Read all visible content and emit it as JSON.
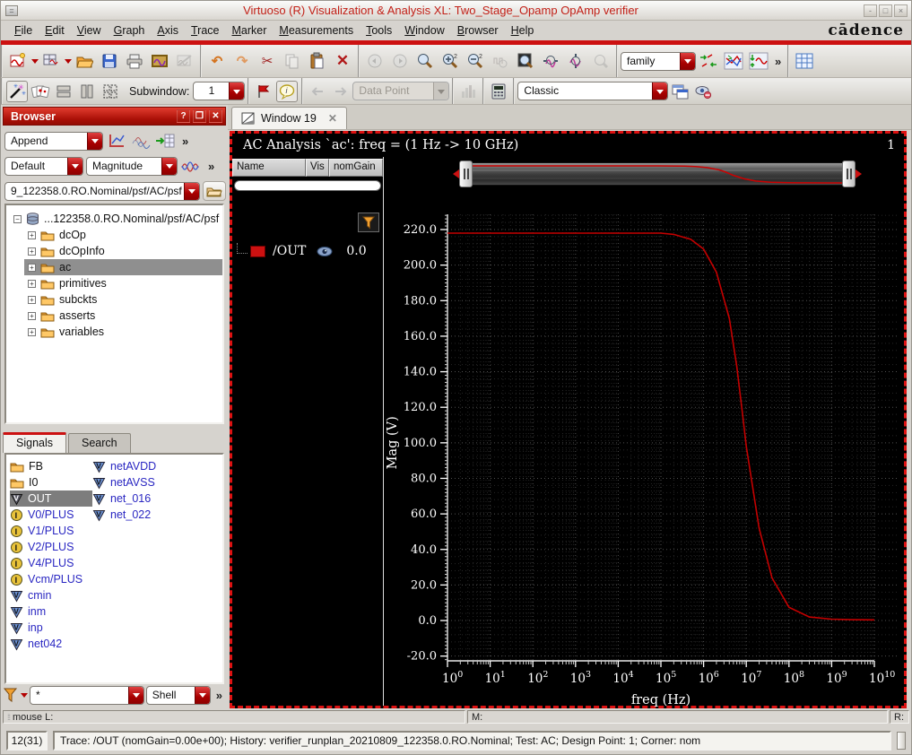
{
  "window": {
    "title": "Virtuoso (R) Visualization & Analysis XL: Two_Stage_Opamp OpAmp verifier",
    "brand": "cādence"
  },
  "menubar": {
    "items": [
      "File",
      "Edit",
      "View",
      "Graph",
      "Axis",
      "Trace",
      "Marker",
      "Measurements",
      "Tools",
      "Window",
      "Browser",
      "Help"
    ]
  },
  "toolbar": {
    "family_value": "family",
    "subwindow_label": "Subwindow:",
    "subwindow_value": "1",
    "datapoint_value": "Data Point",
    "style_value": "Classic"
  },
  "browser": {
    "title": "Browser",
    "append_value": "Append",
    "default_value": "Default",
    "magnitude_value": "Magnitude",
    "dataset_value": "9_122358.0.RO.Nominal/psf/AC/psf",
    "tree": {
      "root": "...122358.0.RO.Nominal/psf/AC/psf",
      "items": [
        "dcOp",
        "dcOpInfo",
        "ac",
        "primitives",
        "subckts",
        "asserts",
        "variables"
      ]
    },
    "tabs": {
      "signals": "Signals",
      "search": "Search"
    },
    "signals_col1": [
      "FB",
      "I0",
      "OUT",
      "V0/PLUS",
      "V1/PLUS",
      "V2/PLUS",
      "V4/PLUS",
      "Vcm/PLUS",
      "cmin",
      "inm",
      "inp",
      "net042"
    ],
    "signals_col2": [
      "netAVDD",
      "netAVSS",
      "net_016",
      "net_022"
    ],
    "filter_value": "*",
    "shell_value": "Shell"
  },
  "graph": {
    "tab_label": "Window 19",
    "subwindow_number": "1",
    "legend": {
      "col_name": "Name",
      "col_vis": "Vis",
      "col_value": "nomGain",
      "trace_name": "/OUT",
      "trace_value": "0.0",
      "swatch_color": "#cc1111"
    }
  },
  "chart_data": {
    "type": "line",
    "title": "AC Analysis `ac': freq = (1 Hz -> 10 GHz)",
    "xlabel": "freq (Hz)",
    "ylabel": "Mag (V)",
    "x_scale": "log",
    "xlim": [
      1,
      10000000000
    ],
    "ylim": [
      -22.7,
      228.6
    ],
    "yticks": [
      -20,
      0,
      20,
      40,
      60,
      80,
      100,
      120,
      140,
      160,
      180,
      200,
      220
    ],
    "grid": true,
    "legend_position": "left",
    "series": [
      {
        "name": "/OUT",
        "color": "#c40000",
        "points": [
          [
            1,
            218
          ],
          [
            10,
            218
          ],
          [
            100,
            218
          ],
          [
            1000,
            218
          ],
          [
            10000,
            218
          ],
          [
            100000,
            218
          ],
          [
            200000,
            217.3
          ],
          [
            500000,
            214.5
          ],
          [
            1000000,
            209
          ],
          [
            2000000,
            196
          ],
          [
            4000000,
            170
          ],
          [
            6000000,
            143
          ],
          [
            8000000,
            118
          ],
          [
            10000000,
            98
          ],
          [
            20000000,
            52
          ],
          [
            40000000,
            24
          ],
          [
            100000000,
            7.5
          ],
          [
            300000000,
            2
          ],
          [
            1000000000,
            0.8
          ],
          [
            3000000000,
            0.45
          ],
          [
            10000000000,
            0.35
          ]
        ]
      }
    ]
  },
  "statusbar": {
    "left": "mouse L:",
    "middle": "M:",
    "right": "R:"
  },
  "bottombar": {
    "counter": "12(31)",
    "message": "Trace: /OUT (nomGain=0.00e+00); History: verifier_runplan_20210809_122358.0.RO.Nominal; Test: AC; Design Point: 1; Corner: nom"
  }
}
